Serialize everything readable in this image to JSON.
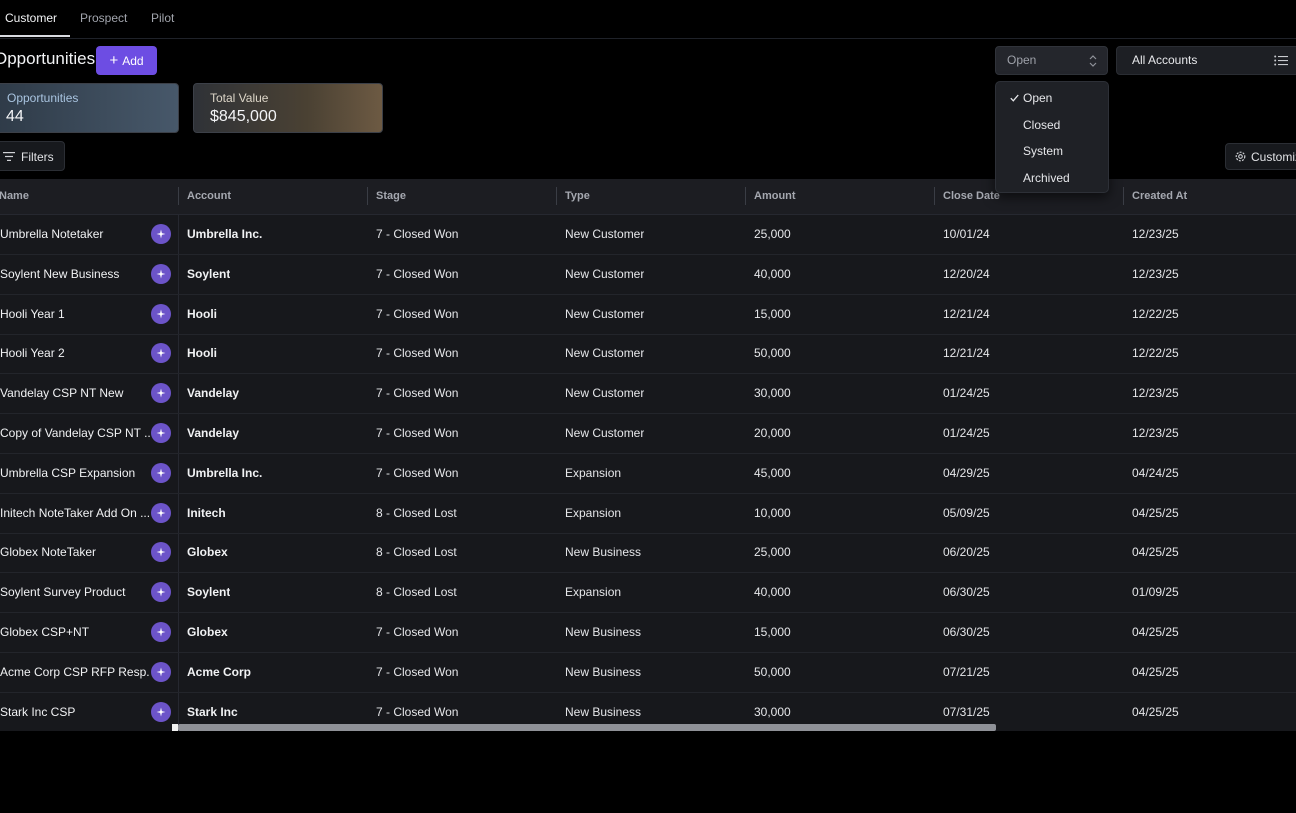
{
  "tabs": [
    "Customer",
    "Prospect",
    "Pilot"
  ],
  "header": {
    "title": "Opportunities",
    "add_label": "Add",
    "status_value": "Open",
    "account_value": "All Accounts"
  },
  "stats": {
    "opportunities_label": "Opportunities",
    "opportunities_value": "44",
    "total_value_label": "Total Value",
    "total_value_value": "$845,000"
  },
  "toolbar": {
    "filters_label": "Filters",
    "customize_label": "Customize"
  },
  "status_options": [
    "Open",
    "Closed",
    "System",
    "Archived"
  ],
  "status_selected": "Open",
  "table": {
    "columns": [
      "Name",
      "Account",
      "Stage",
      "Type",
      "Amount",
      "Close Date",
      "Created At"
    ],
    "rows": [
      {
        "name": "Umbrella Notetaker",
        "account": "Umbrella Inc.",
        "stage": "7 - Closed Won",
        "type": "New Customer",
        "amount": "25,000",
        "close": "10/01/24",
        "created": "12/23/25"
      },
      {
        "name": "Soylent New Business",
        "account": "Soylent",
        "stage": "7 - Closed Won",
        "type": "New Customer",
        "amount": "40,000",
        "close": "12/20/24",
        "created": "12/23/25"
      },
      {
        "name": "Hooli Year 1",
        "account": "Hooli",
        "stage": "7 - Closed Won",
        "type": "New Customer",
        "amount": "15,000",
        "close": "12/21/24",
        "created": "12/22/25"
      },
      {
        "name": "Hooli Year 2",
        "account": "Hooli",
        "stage": "7 - Closed Won",
        "type": "New Customer",
        "amount": "50,000",
        "close": "12/21/24",
        "created": "12/22/25"
      },
      {
        "name": "Vandelay CSP NT New",
        "account": "Vandelay",
        "stage": "7 - Closed Won",
        "type": "New Customer",
        "amount": "30,000",
        "close": "01/24/25",
        "created": "12/23/25"
      },
      {
        "name": "Copy of Vandelay CSP NT ...",
        "account": "Vandelay",
        "stage": "7 - Closed Won",
        "type": "New Customer",
        "amount": "20,000",
        "close": "01/24/25",
        "created": "12/23/25"
      },
      {
        "name": "Umbrella CSP Expansion",
        "account": "Umbrella Inc.",
        "stage": "7 - Closed Won",
        "type": "Expansion",
        "amount": "45,000",
        "close": "04/29/25",
        "created": "04/24/25"
      },
      {
        "name": "Initech NoteTaker Add On ...",
        "account": "Initech",
        "stage": "8 - Closed Lost",
        "type": "Expansion",
        "amount": "10,000",
        "close": "05/09/25",
        "created": "04/25/25"
      },
      {
        "name": "Globex NoteTaker",
        "account": "Globex",
        "stage": "8 - Closed Lost",
        "type": "New Business",
        "amount": "25,000",
        "close": "06/20/25",
        "created": "04/25/25"
      },
      {
        "name": "Soylent Survey Product",
        "account": "Soylent",
        "stage": "8 - Closed Lost",
        "type": "Expansion",
        "amount": "40,000",
        "close": "06/30/25",
        "created": "01/09/25"
      },
      {
        "name": "Globex CSP+NT",
        "account": "Globex",
        "stage": "7 - Closed Won",
        "type": "New Business",
        "amount": "15,000",
        "close": "06/30/25",
        "created": "04/25/25"
      },
      {
        "name": "Acme Corp CSP RFP Resp...",
        "account": "Acme Corp",
        "stage": "7 - Closed Won",
        "type": "New Business",
        "amount": "50,000",
        "close": "07/21/25",
        "created": "04/25/25"
      },
      {
        "name": "Stark Inc CSP",
        "account": "Stark Inc",
        "stage": "7 - Closed Won",
        "type": "New Business",
        "amount": "30,000",
        "close": "07/31/25",
        "created": "04/25/25"
      }
    ]
  },
  "colors": {
    "accent": "#6d4de3",
    "ai_badge": "#6c54c9",
    "background": "#000000",
    "table_bg": "#17181c"
  },
  "icons": {
    "add": "plus-icon",
    "status_select": "chevron-updown-icon",
    "account_select": "list-icon",
    "filters": "filter-icon",
    "customize": "gear-icon",
    "row_action": "sparkle-icon",
    "selected_option": "check-icon"
  }
}
